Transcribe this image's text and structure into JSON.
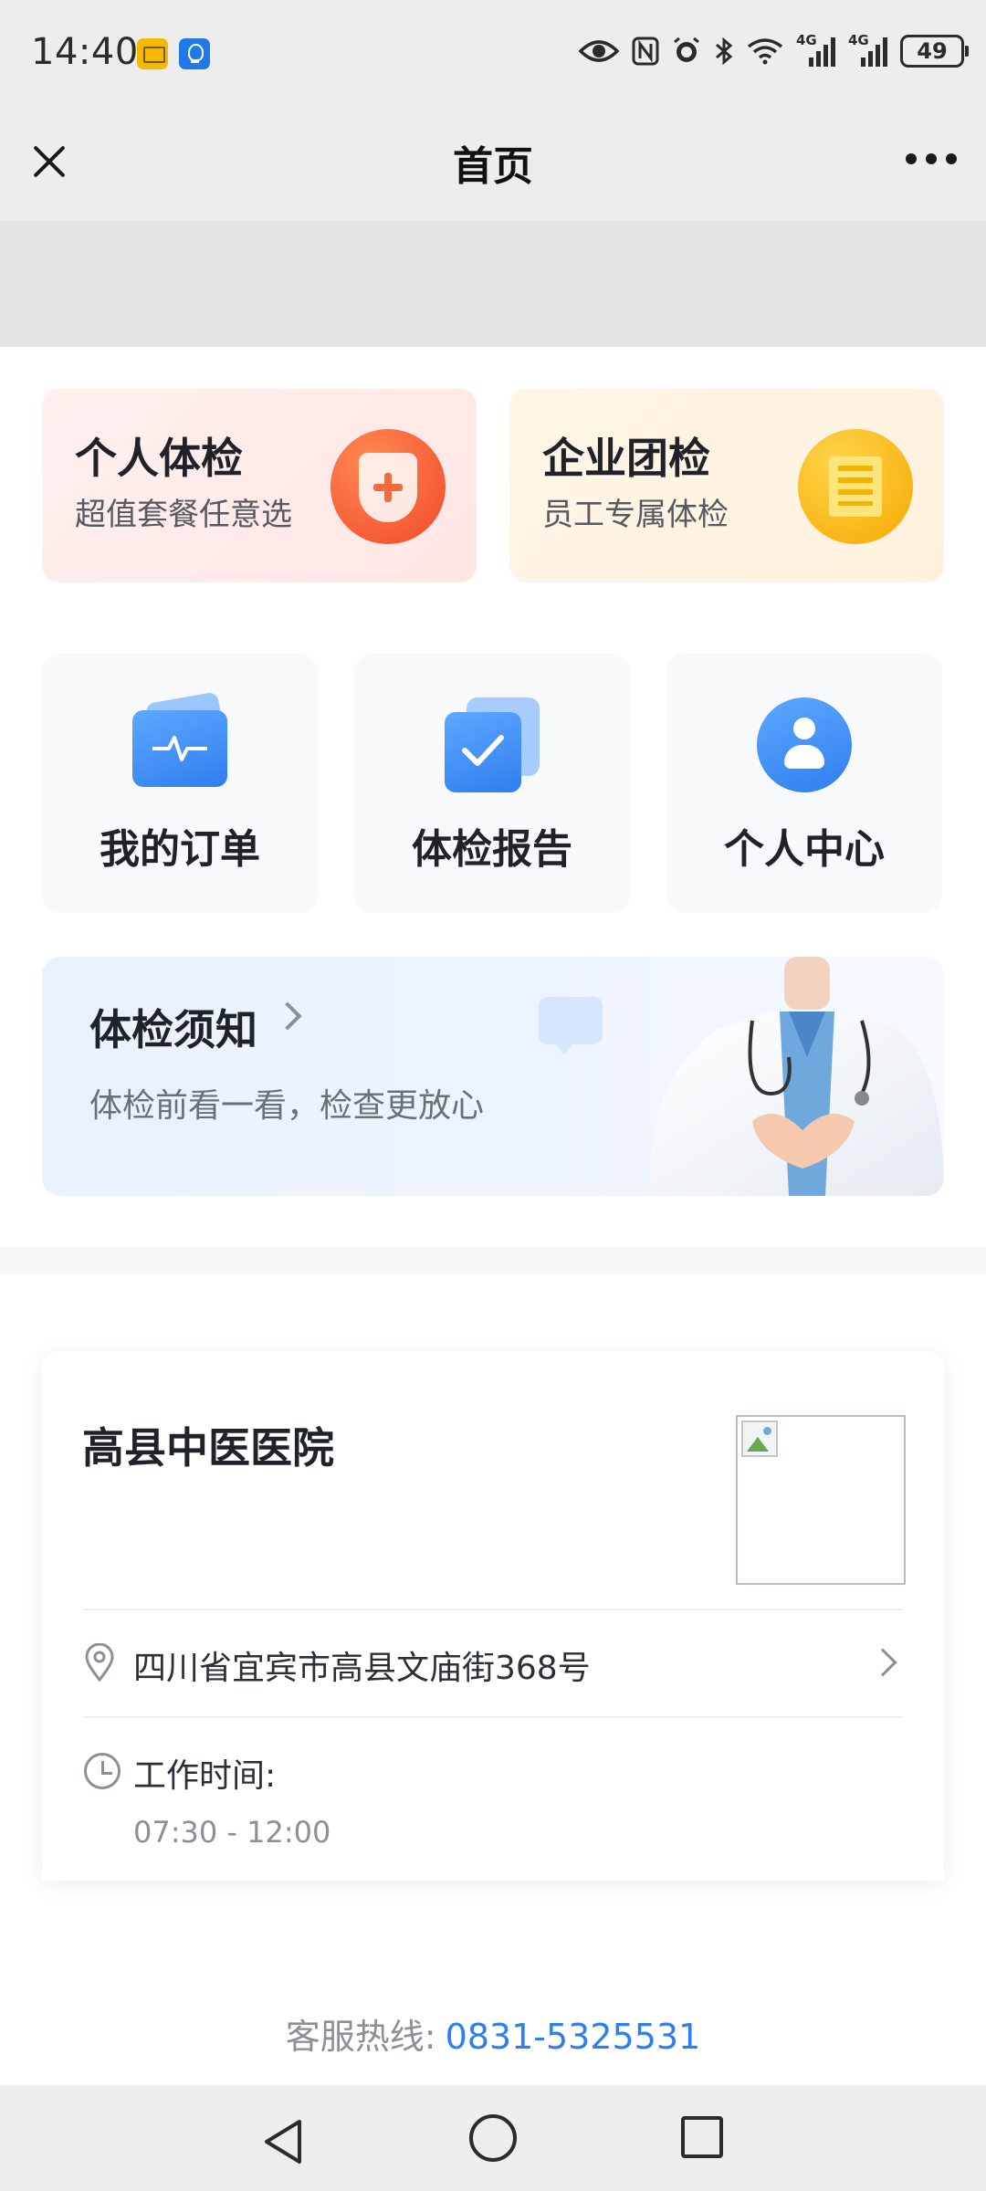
{
  "status_bar": {
    "time": "14:40",
    "battery": "49",
    "signal1_label": "4G",
    "signal2_label": "4G",
    "icons": [
      "mail-notification-icon",
      "bulb-notification-icon",
      "eye-icon",
      "nfc-icon",
      "alarm-icon",
      "bluetooth-icon",
      "wifi-icon",
      "signal-icon",
      "battery-icon"
    ]
  },
  "nav": {
    "title": "首页",
    "close_icon": "close-icon",
    "more_icon": "more-icon"
  },
  "top_cards": [
    {
      "title": "个人体检",
      "subtitle": "超值套餐任意选",
      "icon": "shield-plus-icon",
      "accent": "#f1482a"
    },
    {
      "title": "企业团检",
      "subtitle": "员工专属体检",
      "icon": "building-icon",
      "accent": "#f5a800"
    }
  ],
  "tiles": [
    {
      "label": "我的订单",
      "icon": "order-icon"
    },
    {
      "label": "体检报告",
      "icon": "report-check-icon"
    },
    {
      "label": "个人中心",
      "icon": "person-icon"
    }
  ],
  "notice": {
    "title": "体检须知",
    "subtitle": "体检前看一看，检查更放心"
  },
  "hospital": {
    "name": "高县中医医院",
    "address": "四川省宜宾市高县文庙街368号",
    "work_time_label": "工作时间:",
    "work_time_value": "07:30 - 12:00"
  },
  "footer": {
    "hotline_label": "客服热线:",
    "hotline_number": "0831-5325531"
  },
  "colors": {
    "accent_blue": "#2f7ef0",
    "header_gray": "#ededed"
  }
}
